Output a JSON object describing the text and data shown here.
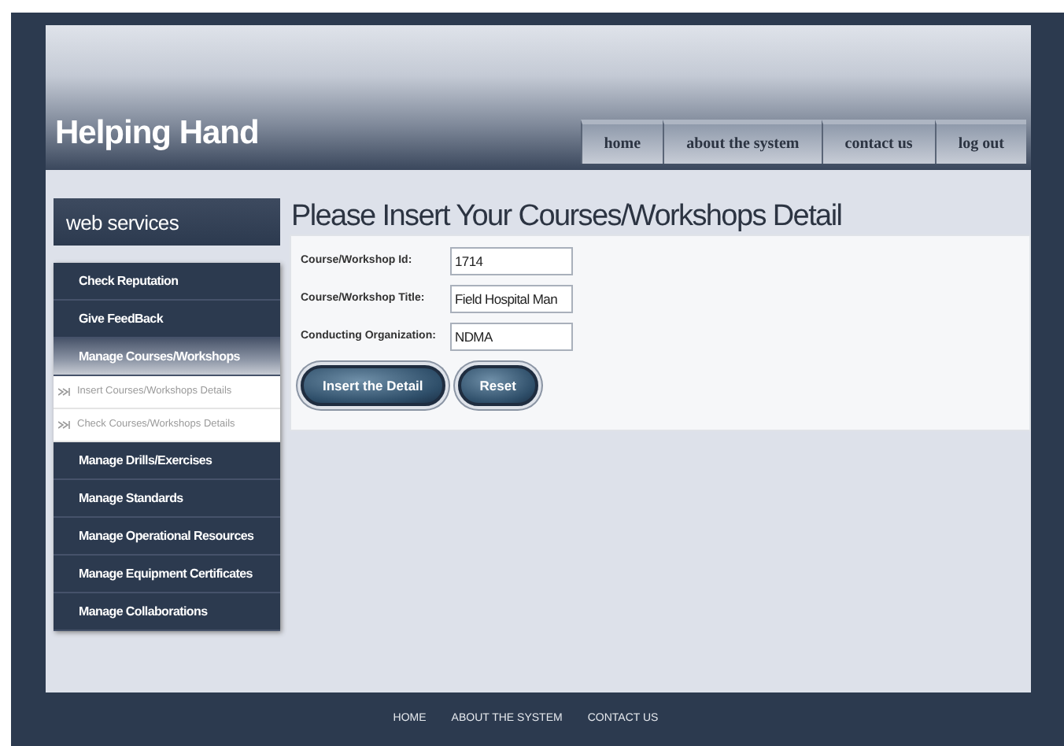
{
  "site_title": "Helping Hand",
  "nav": [
    {
      "label": "home"
    },
    {
      "label": "about the system"
    },
    {
      "label": "contact us"
    },
    {
      "label": "log out"
    }
  ],
  "sidebar": {
    "title": "web services",
    "items": [
      {
        "label": "Check Reputation",
        "expanded": false
      },
      {
        "label": "Give FeedBack",
        "expanded": false
      },
      {
        "label": "Manage Courses/Workshops",
        "expanded": true,
        "children": [
          {
            "label": "Insert Courses/Workshops Details"
          },
          {
            "label": "Check Courses/Workshops Details"
          }
        ]
      },
      {
        "label": "Manage Drills/Exercises",
        "expanded": false
      },
      {
        "label": "Manage Standards",
        "expanded": false
      },
      {
        "label": "Manage Operational Resources",
        "expanded": false
      },
      {
        "label": "Manage Equipment Certificates",
        "expanded": false
      },
      {
        "label": "Manage Collaborations",
        "expanded": false
      }
    ]
  },
  "form": {
    "title": "Please Insert Your Courses/Workshops Detail",
    "fields": [
      {
        "label": "Course/Workshop Id:",
        "value": "1714"
      },
      {
        "label": "Course/Workshop Title:",
        "value": "Field Hospital Man"
      },
      {
        "label": "Conducting Organization:",
        "value": "NDMA"
      }
    ],
    "buttons": [
      {
        "label": "Insert the Detail"
      },
      {
        "label": "Reset"
      }
    ]
  },
  "footer": [
    {
      "label": "HOME"
    },
    {
      "label": "ABOUT THE SYSTEM"
    },
    {
      "label": "CONTACT US"
    }
  ]
}
